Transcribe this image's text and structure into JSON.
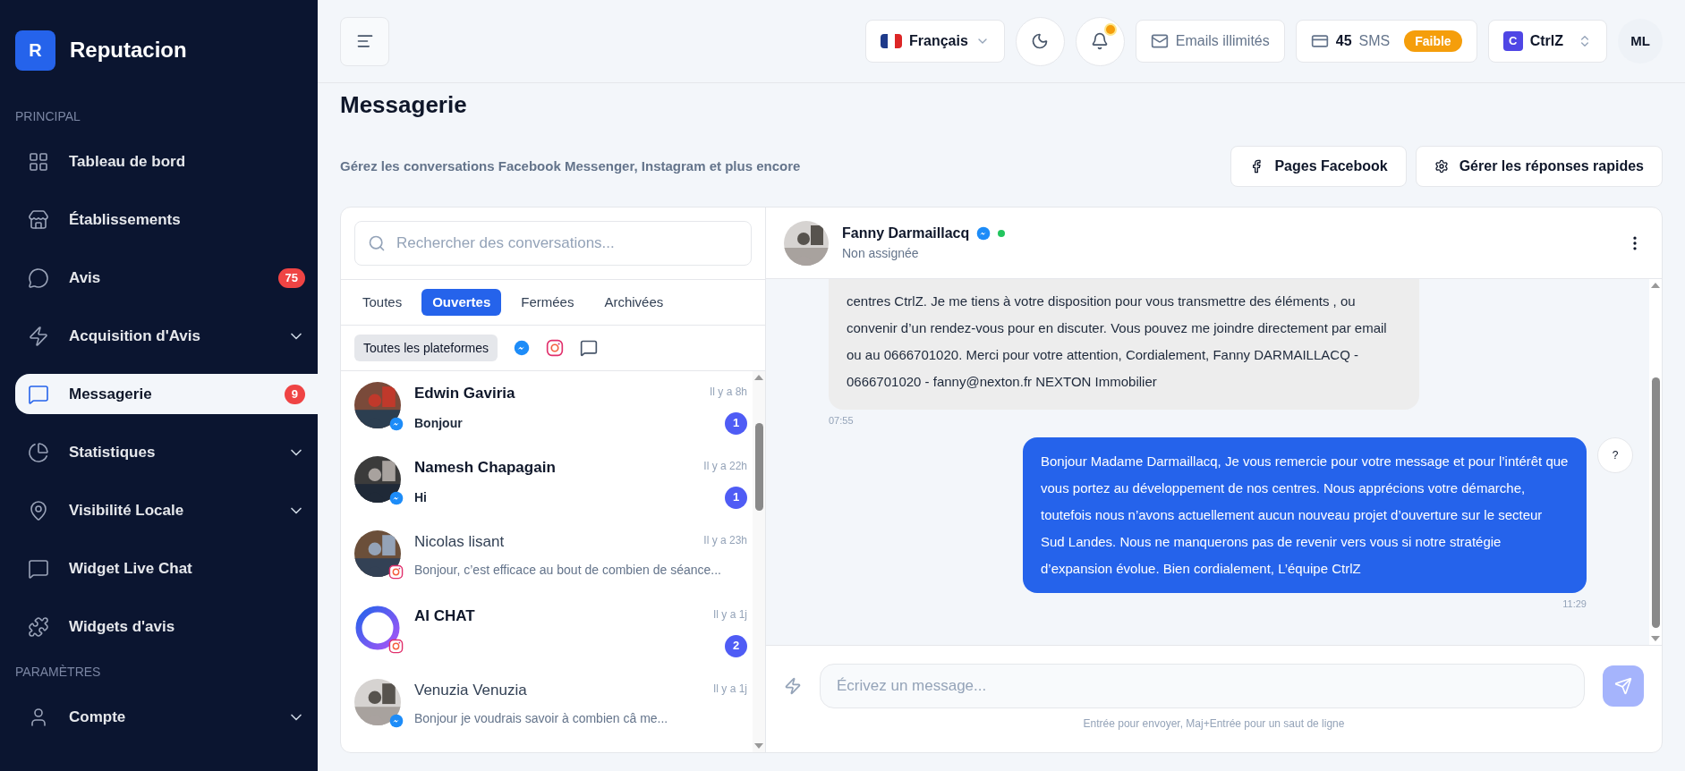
{
  "brand": {
    "logo_letter": "R",
    "name": "Reputacion"
  },
  "sidebar": {
    "sections": [
      {
        "title": "PRINCIPAL",
        "items": [
          {
            "label": "Tableau de bord",
            "selected": false
          },
          {
            "label": "Établissements",
            "selected": false
          },
          {
            "label": "Avis",
            "selected": false,
            "badge": "75"
          },
          {
            "label": "Acquisition d'Avis",
            "selected": false,
            "expandable": true
          },
          {
            "label": "Messagerie",
            "selected": true,
            "badge": "9"
          },
          {
            "label": "Statistiques",
            "selected": false,
            "expandable": true
          },
          {
            "label": "Visibilité Locale",
            "selected": false,
            "expandable": true
          },
          {
            "label": "Widget Live Chat",
            "selected": false
          },
          {
            "label": "Widgets d'avis",
            "selected": false
          }
        ]
      },
      {
        "title": "PARAMÈTRES",
        "items": [
          {
            "label": "Compte",
            "selected": false,
            "expandable": true
          }
        ]
      }
    ]
  },
  "topbar": {
    "language": "Français",
    "notifications_dot": true,
    "emails": "Emails illimités",
    "sms_count": "45",
    "sms_label": "SMS",
    "sms_status": "Faible",
    "account_letter": "C",
    "account": "CtrlZ",
    "user_initials": "ML"
  },
  "page": {
    "title": "Messagerie",
    "subtitle": "Gérez les conversations Facebook Messenger, Instagram et plus encore",
    "actions": [
      "Pages Facebook",
      "Gérer les réponses rapides"
    ]
  },
  "conversations": {
    "search_placeholder": "Rechercher des conversations...",
    "tabs": [
      {
        "label": "Toutes",
        "selected": false
      },
      {
        "label": "Ouvertes",
        "selected": true
      },
      {
        "label": "Fermées",
        "selected": false
      },
      {
        "label": "Archivées",
        "selected": false
      }
    ],
    "platform_filter": {
      "label": "Toutes les plateformes",
      "selected": true
    },
    "items": [
      {
        "name": "Edwin Gaviria",
        "preview": "Bonjour",
        "time": "Il y a 8h",
        "unread": true,
        "count": "1",
        "kind": "messenger"
      },
      {
        "name": "Namesh Chapagain",
        "preview": "Hi",
        "time": "Il y a 22h",
        "unread": true,
        "count": "1",
        "kind": "messenger"
      },
      {
        "name": "Nicolas lisant",
        "preview": "Bonjour, c’est efficace au bout de combien de séance...",
        "time": "Il y a 23h",
        "unread": false,
        "kind": "instagram"
      },
      {
        "name": "AI CHAT",
        "time": "Il y a 1j",
        "unread": true,
        "count": "2",
        "kind": "instagram"
      },
      {
        "name": "Venuzia Venuzia",
        "preview": "Bonjour je voudrais savoir à combien câ me...",
        "time": "Il y a 1j",
        "unread": false,
        "kind": "messenger"
      }
    ]
  },
  "chat": {
    "contact": "Fanny Darmaillacq",
    "online": true,
    "assignment": "Non assignée",
    "messages": [
      {
        "kind": "incoming",
        "text": "centres CtrlZ. Je me tiens à votre disposition pour vous transmettre des éléments , ou convenir d’un rendez-vous pour en discuter. Vous pouvez me joindre directement par email ou au 0666701020. Merci pour votre attention, Cordialement, Fanny DARMAILLACQ - 0666701020 - fanny@nexton.fr NEXTON Immobilier",
        "time": "07:55"
      },
      {
        "kind": "outgoing",
        "text": "Bonjour Madame Darmaillacq, Je vous remercie pour votre message et pour l’intérêt que vous portez au développement de nos centres. Nous apprécions votre démarche, toutefois nous n’avons actuellement aucun nouveau projet d’ouverture sur le secteur Sud Landes. Nous ne manquerons pas de revenir vers vous si notre stratégie d’expansion évolue. Bien cordialement, L’équipe CtrlZ",
        "time": "11:29",
        "status": "?"
      }
    ],
    "composer_placeholder": "Écrivez un message...",
    "hint": "Entrée pour envoyer, Maj+Entrée pour un saut de ligne"
  }
}
